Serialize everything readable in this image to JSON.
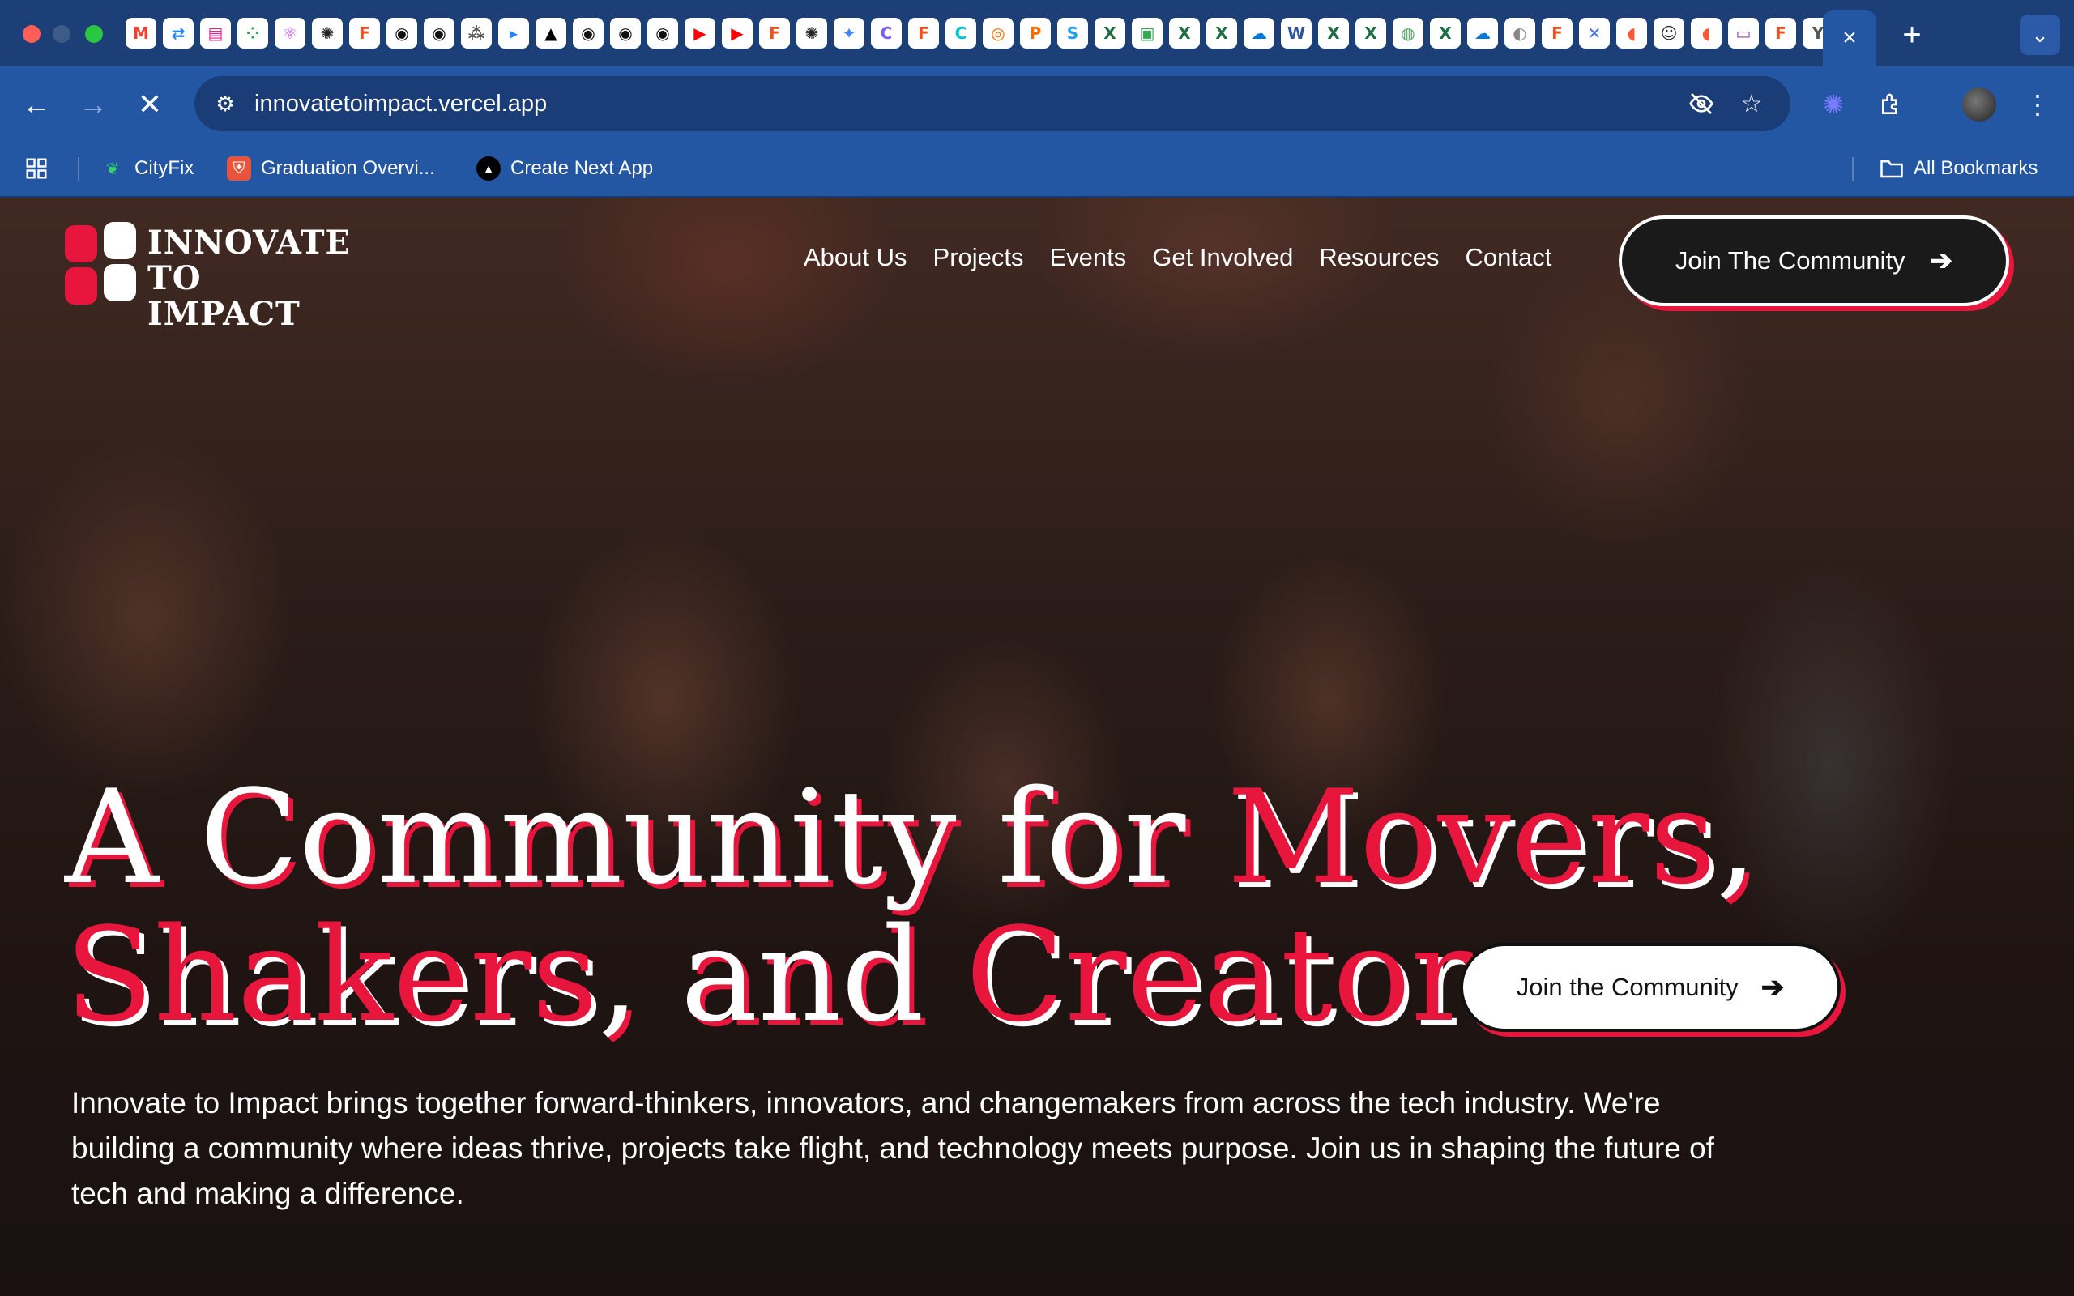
{
  "browser": {
    "url": "innovatetoimpact.vercel.app",
    "tab_close": "×",
    "new_tab": "+",
    "tab_menu": "⌄",
    "bookmarks": [
      {
        "label": "CityFix",
        "icon": "plant-icon"
      },
      {
        "label": "Graduation Overvi...",
        "icon": "shield-icon"
      },
      {
        "label": "Create Next App",
        "icon": "triangle-icon"
      }
    ],
    "all_bookmarks": "All Bookmarks",
    "favicons": [
      {
        "glyph": "M",
        "color": "#ea4335"
      },
      {
        "glyph": "⇄",
        "color": "#2684ff"
      },
      {
        "glyph": "▤",
        "color": "#e91e8c"
      },
      {
        "glyph": "⁘",
        "color": "#34a853"
      },
      {
        "glyph": "⚛",
        "color": "#c048e0"
      },
      {
        "glyph": "✺",
        "color": "#222"
      },
      {
        "glyph": "F",
        "color": "#f24e1e"
      },
      {
        "glyph": "◉",
        "color": "#111"
      },
      {
        "glyph": "◉",
        "color": "#111"
      },
      {
        "glyph": "⁂",
        "color": "#555"
      },
      {
        "glyph": "▸",
        "color": "#2684ff"
      },
      {
        "glyph": "▲",
        "color": "#000"
      },
      {
        "glyph": "◉",
        "color": "#111"
      },
      {
        "glyph": "◉",
        "color": "#111"
      },
      {
        "glyph": "◉",
        "color": "#111"
      },
      {
        "glyph": "▶",
        "color": "#ff0000"
      },
      {
        "glyph": "▶",
        "color": "#ff0000"
      },
      {
        "glyph": "F",
        "color": "#f24e1e"
      },
      {
        "glyph": "✺",
        "color": "#222"
      },
      {
        "glyph": "✦",
        "color": "#4285f4"
      },
      {
        "glyph": "C",
        "color": "#7b5cf5"
      },
      {
        "glyph": "F",
        "color": "#f24e1e"
      },
      {
        "glyph": "C",
        "color": "#00c4cc"
      },
      {
        "glyph": "◎",
        "color": "#ff6a00"
      },
      {
        "glyph": "P",
        "color": "#ff6a00"
      },
      {
        "glyph": "S",
        "color": "#1da1f2"
      },
      {
        "glyph": "X",
        "color": "#1d6f42"
      },
      {
        "glyph": "▣",
        "color": "#34a853"
      },
      {
        "glyph": "X",
        "color": "#1d6f42"
      },
      {
        "glyph": "X",
        "color": "#1d6f42"
      },
      {
        "glyph": "☁",
        "color": "#0078d4"
      },
      {
        "glyph": "W",
        "color": "#2b579a"
      },
      {
        "glyph": "X",
        "color": "#1d6f42"
      },
      {
        "glyph": "X",
        "color": "#1d6f42"
      },
      {
        "glyph": "◍",
        "color": "#5a6"
      },
      {
        "glyph": "X",
        "color": "#1d6f42"
      },
      {
        "glyph": "☁",
        "color": "#0078d4"
      },
      {
        "glyph": "◐",
        "color": "#888"
      },
      {
        "glyph": "F",
        "color": "#f24e1e"
      },
      {
        "glyph": "✕",
        "color": "#4a6cf7"
      },
      {
        "glyph": "◖",
        "color": "#ff5733"
      },
      {
        "glyph": "☺",
        "color": "#333"
      },
      {
        "glyph": "◖",
        "color": "#ff5733"
      },
      {
        "glyph": "▭",
        "color": "#8e44ad"
      },
      {
        "glyph": "F",
        "color": "#f24e1e"
      },
      {
        "glyph": "Y",
        "color": "#555"
      }
    ]
  },
  "site": {
    "logo_line1": "INNOVATE",
    "logo_line2": "TO IMPACT",
    "nav": [
      "About Us",
      "Projects",
      "Events",
      "Get Involved",
      "Resources",
      "Contact"
    ],
    "header_cta": "Join The Community",
    "hero": {
      "line1_a": "A Community for ",
      "line1_b": "Movers",
      "line1_c": ",",
      "line2_a": "Shakers",
      "line2_b": ", and ",
      "line2_c": "Creators",
      "cta": "Join the Community",
      "description": "Innovate to Impact brings together forward-thinkers, innovators, and changemakers from across the tech industry. We're building a community where ideas thrive, projects take flight, and technology meets purpose. Join us in shaping the future of tech and making a difference."
    },
    "accent_color": "#e8163d"
  }
}
